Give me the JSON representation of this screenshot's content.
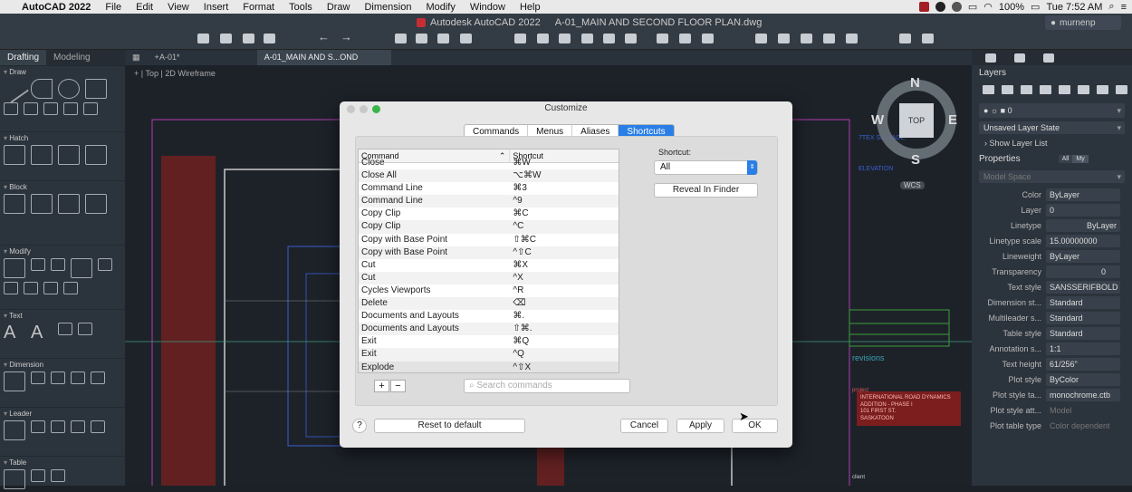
{
  "menubar": {
    "app": "AutoCAD 2022",
    "items": [
      "File",
      "Edit",
      "View",
      "Insert",
      "Format",
      "Tools",
      "Draw",
      "Dimension",
      "Modify",
      "Window",
      "Help"
    ],
    "battery": "100%",
    "clock": "Tue 7:52 AM"
  },
  "window": {
    "title": "Autodesk AutoCAD 2022",
    "document": "A-01_MAIN AND SECOND FLOOR PLAN.dwg",
    "user": "murnenp"
  },
  "left_panel": {
    "tabs": [
      "Drafting",
      "Modeling"
    ],
    "sections": [
      "Draw",
      "Hatch",
      "Block",
      "Modify",
      "Text",
      "Dimension",
      "Leader",
      "Table"
    ]
  },
  "doc_tabs": {
    "layout": "A-01*",
    "active": "A-01_MAIN AND S...OND FLOOR PLAN"
  },
  "viewport": {
    "label": "Top",
    "visual_style": "2D Wireframe"
  },
  "viewcube": {
    "north": "N",
    "south": "S",
    "east": "E",
    "west": "W",
    "top": "TOP",
    "wcs": "WCS"
  },
  "dialog": {
    "title": "Customize",
    "tabs": [
      "Commands",
      "Menus",
      "Aliases",
      "Shortcuts"
    ],
    "active_tab": "Shortcuts",
    "table_headers": {
      "command": "Command",
      "shortcut": "Shortcut"
    },
    "rows": [
      {
        "command": "Close",
        "shortcut": "⌘W"
      },
      {
        "command": "Close All",
        "shortcut": "⌥⌘W"
      },
      {
        "command": "Command Line",
        "shortcut": "⌘3"
      },
      {
        "command": "Command Line",
        "shortcut": "^9"
      },
      {
        "command": "Copy Clip",
        "shortcut": "⌘C"
      },
      {
        "command": "Copy Clip",
        "shortcut": "^C"
      },
      {
        "command": "Copy with Base Point",
        "shortcut": "⇧⌘C"
      },
      {
        "command": "Copy with Base Point",
        "shortcut": "^⇧C"
      },
      {
        "command": "Cut",
        "shortcut": "⌘X"
      },
      {
        "command": "Cut",
        "shortcut": "^X"
      },
      {
        "command": "Cycles Viewports",
        "shortcut": "^R"
      },
      {
        "command": "Delete",
        "shortcut": "⌫"
      },
      {
        "command": "Documents and Layouts",
        "shortcut": "⌘."
      },
      {
        "command": "Documents and Layouts",
        "shortcut": "⇧⌘."
      },
      {
        "command": "Exit",
        "shortcut": "⌘Q"
      },
      {
        "command": "Exit",
        "shortcut": "^Q"
      },
      {
        "command": "Explode",
        "shortcut": "^⇧X"
      }
    ],
    "shortcut_label": "Shortcut:",
    "shortcut_filter": "All",
    "reveal_button": "Reveal In Finder",
    "add": "+",
    "remove": "−",
    "search_placeholder": "Search commands",
    "help": "?",
    "reset_button": "Reset to default",
    "cancel_button": "Cancel",
    "apply_button": "Apply",
    "ok_button": "OK"
  },
  "right_panel": {
    "layers_title": "Layers",
    "layer_current": "0",
    "layer_state": "Unsaved Layer State",
    "show_layer_list": "Show Layer List",
    "properties_title": "Properties",
    "prop_tab_all": "All",
    "prop_tab_my": "My",
    "model_space": "Model Space",
    "properties": [
      {
        "label": "Color",
        "value": "ByLayer"
      },
      {
        "label": "Layer",
        "value": "0"
      },
      {
        "label": "Linetype",
        "value": "ByLayer"
      },
      {
        "label": "Linetype scale",
        "value": "15.00000000"
      },
      {
        "label": "Lineweight",
        "value": "ByLayer"
      },
      {
        "label": "Transparency",
        "value": "0"
      },
      {
        "label": "Text style",
        "value": "SANSSERIFBOLD"
      },
      {
        "label": "Dimension st...",
        "value": "Standard"
      },
      {
        "label": "Multileader s...",
        "value": "Standard"
      },
      {
        "label": "Table style",
        "value": "Standard"
      },
      {
        "label": "Annotation s...",
        "value": "1:1"
      },
      {
        "label": "Text height",
        "value": "61/256\""
      },
      {
        "label": "Plot style",
        "value": "ByColor"
      },
      {
        "label": "Plot style ta...",
        "value": "monochrome.ctb"
      },
      {
        "label": "Plot style att...",
        "value": "Model"
      },
      {
        "label": "Plot table type",
        "value": "Color dependent"
      }
    ]
  },
  "drawing": {
    "revisions": "revisions",
    "project": "project",
    "client": "client",
    "title_lines": [
      "INTERNATIONAL ROAD DYNAMICS",
      "ADDITION - PHASE I",
      "101 FIRST ST.",
      "SASKATOON"
    ]
  }
}
